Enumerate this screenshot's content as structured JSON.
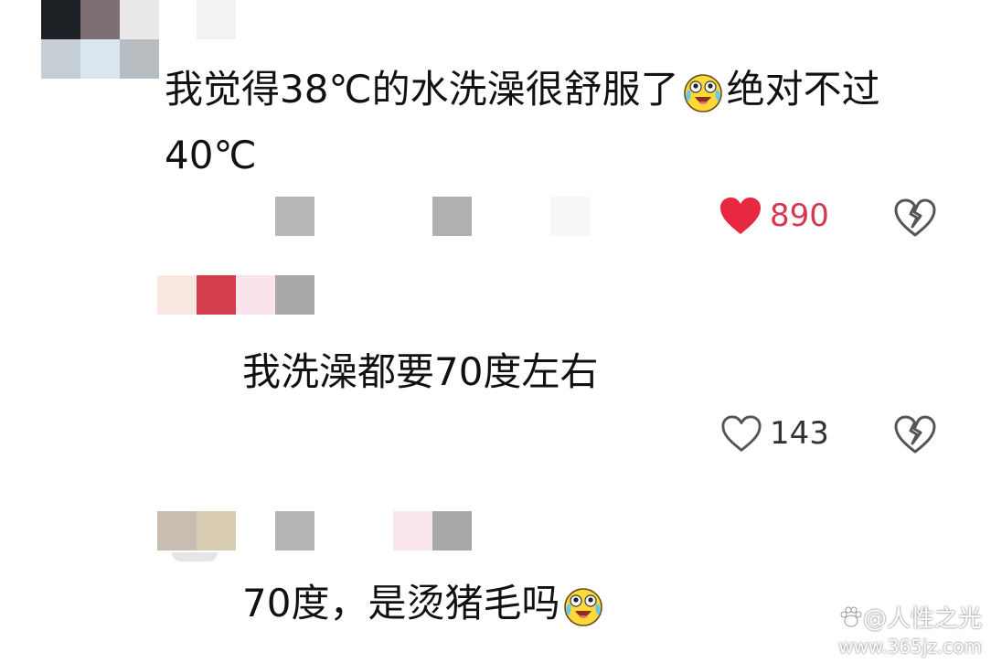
{
  "comments": [
    {
      "text_before_emoji": "我觉得38℃的水洗澡很舒服了",
      "text_after_emoji": "绝对不过",
      "text_line2": "40℃",
      "likes": "890",
      "liked": true
    },
    {
      "text": "我洗澡都要70度左右",
      "likes": "143",
      "liked": false
    },
    {
      "text": "70度，是烫猪毛吗"
    }
  ],
  "watermark": {
    "line1": "@人性之光",
    "line2": "www.365jz.com"
  },
  "icons": {
    "like": "heart-icon",
    "dislike": "broken-heart-icon",
    "emoji": "crying-laughing-emoji",
    "watermark_logo": "paw-icon"
  },
  "colors": {
    "liked_heart": "#e8283f",
    "liked_count": "#d8374d",
    "icon_gray": "#555555"
  }
}
